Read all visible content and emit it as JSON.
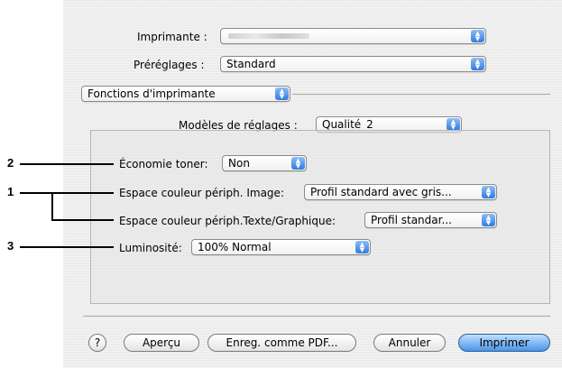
{
  "printer": {
    "label": "Imprimante :",
    "value_blurred": true
  },
  "presets": {
    "label": "Préréglages :",
    "value": "Standard"
  },
  "section": {
    "value": "Fonctions d'imprimante"
  },
  "settings_models": {
    "label": "Modèles de réglages :",
    "value": "Qualité_2"
  },
  "options": {
    "toner_saving": {
      "label": "Économie toner:",
      "value": "Non"
    },
    "image_color_space": {
      "label": "Espace couleur périph. Image:",
      "value": "Profil standard avec gris..."
    },
    "text_color_space": {
      "label": "Espace couleur périph.Texte/Graphique:",
      "value": "Profil standar..."
    },
    "brightness": {
      "label": "Luminosité:",
      "value": "100% Normal"
    }
  },
  "callouts": [
    "1",
    "2",
    "3"
  ],
  "buttons": {
    "help": "?",
    "preview": "Aperçu",
    "save_pdf": "Enreg. comme PDF...",
    "cancel": "Annuler",
    "print": "Imprimer"
  },
  "colors": {
    "accent": "#2f7ce0",
    "dialog_bg": "#ececec"
  },
  "icons": {
    "popup_arrows": "up-down-arrows-icon"
  }
}
